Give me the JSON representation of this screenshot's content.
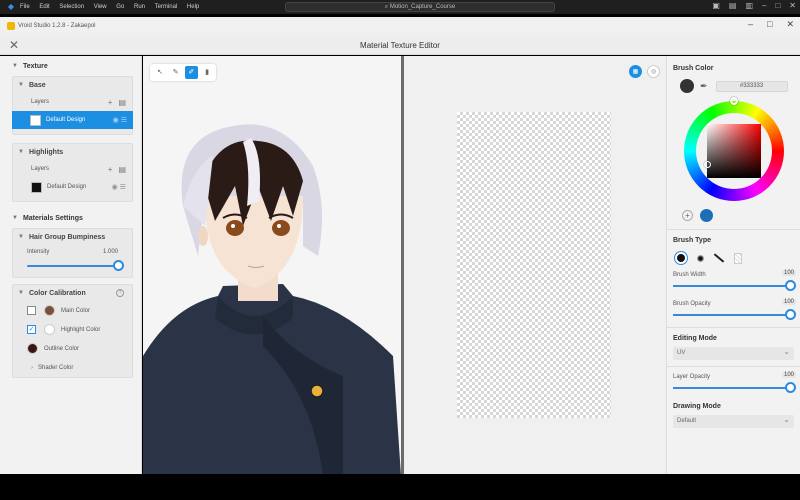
{
  "vscode": {
    "menu": [
      "File",
      "Edit",
      "Selection",
      "View",
      "Go",
      "Run",
      "Terminal",
      "Help"
    ],
    "search": "Motion_Capture_Course"
  },
  "app": {
    "window_title": "Vroid Studio 1.2.8 - Zakaepol"
  },
  "dialog": {
    "title": "Material Texture Editor"
  },
  "left": {
    "texture_label": "Texture",
    "base": {
      "title": "Base",
      "layers_label": "Layers",
      "layer_name": "Default Design"
    },
    "highlights": {
      "title": "Highlights",
      "layers_label": "Layers",
      "layer_name": "Default Design"
    },
    "materials_label": "Materials Settings",
    "hair_bumpiness": {
      "title": "Hair Group Bumpiness",
      "intensity_label": "Intensity",
      "intensity_value": "1.000"
    },
    "color_calibration": {
      "title": "Color Calibration",
      "main_color": "Main Color",
      "highlight_color": "Highlight Color",
      "outline_color": "Outline Color",
      "shader_color": "Shader Color"
    }
  },
  "colors": {
    "main_color": "#7a5038",
    "highlight_color": "#ffffff",
    "outline_color": "#3b1416",
    "accent": "#1d8fe3",
    "current_brush": "#333333",
    "palette_1": "#1c6fb6"
  },
  "right": {
    "brush_color_label": "Brush Color",
    "hex_value": "#333333",
    "brush_type_label": "Brush Type",
    "brush_width_label": "Brush Width",
    "brush_width_value": "100",
    "brush_opacity_label": "Brush Opacity",
    "brush_opacity_value": "100",
    "editing_mode_label": "Editing Mode",
    "editing_mode_value": "UV",
    "layer_opacity_label": "Layer Opacity",
    "layer_opacity_value": "100",
    "drawing_mode_label": "Drawing Mode",
    "drawing_mode_value": "Default"
  }
}
